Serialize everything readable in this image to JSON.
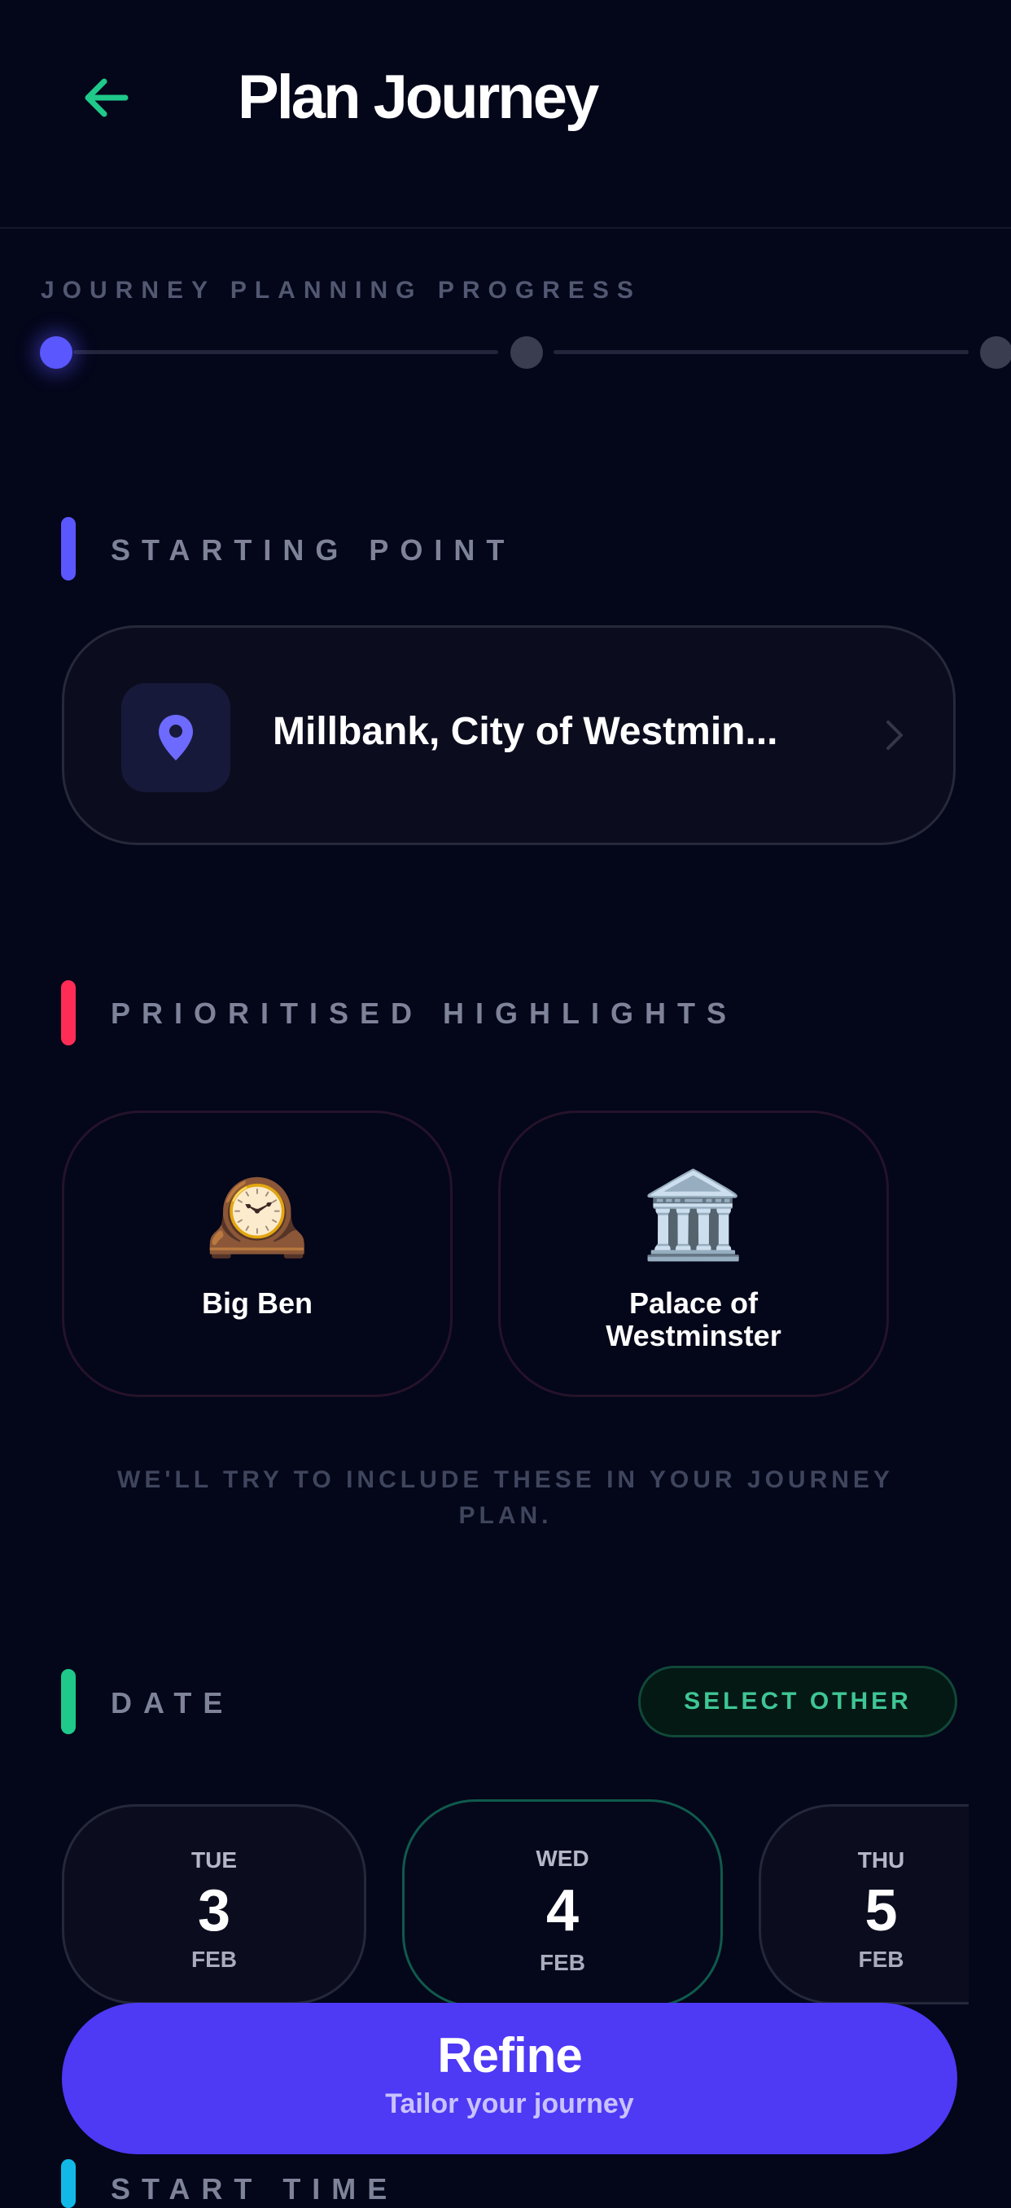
{
  "header": {
    "title": "Plan Journey"
  },
  "progress": {
    "label": "JOURNEY PLANNING PROGRESS",
    "current_step": 1,
    "total_steps": 3
  },
  "starting_point": {
    "label": "STARTING POINT",
    "location": "Millbank, City of Westmin..."
  },
  "highlights": {
    "label": "PRIORITISED HIGHLIGHTS",
    "items": [
      {
        "name_line1": "Big Ben",
        "name_line2": "",
        "icon": "mantelpiece-clock-icon"
      },
      {
        "name_line1": "Palace of",
        "name_line2": "Westminster",
        "icon": "classical-building-icon"
      }
    ],
    "note_line1": "WE'LL TRY TO INCLUDE THESE IN YOUR JOURNEY",
    "note_line2": "PLAN."
  },
  "date": {
    "label": "DATE",
    "select_other": "SELECT OTHER",
    "options": [
      {
        "dow": "TUE",
        "day": "3",
        "month": "FEB"
      },
      {
        "dow": "WED",
        "day": "4",
        "month": "FEB"
      },
      {
        "dow": "THU",
        "day": "5",
        "month": "FEB"
      }
    ]
  },
  "refine": {
    "title": "Refine",
    "subtitle": "Tailor your journey"
  },
  "start_time": {
    "label": "START TIME"
  },
  "colors": {
    "background": "#04061A",
    "accent_green": "#1FC98A",
    "accent_indigo": "#5A57FF",
    "accent_red": "#FF2D55",
    "accent_cyan": "#12B9E6",
    "button": "#4E39F5"
  }
}
